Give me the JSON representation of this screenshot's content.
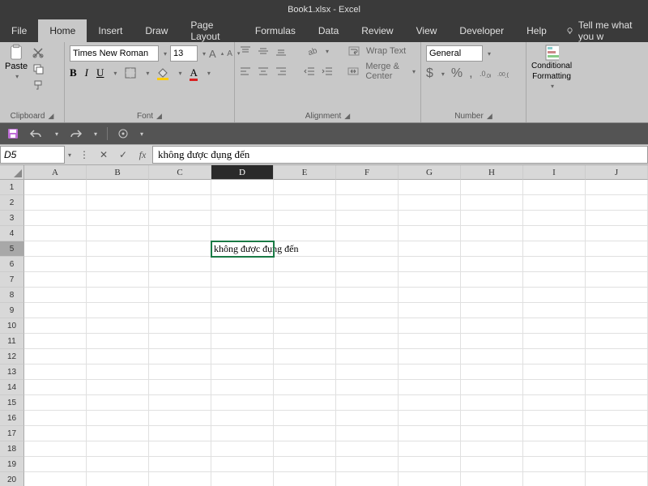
{
  "title": "Book1.xlsx - Excel",
  "menu": {
    "tabs": [
      "File",
      "Home",
      "Insert",
      "Draw",
      "Page Layout",
      "Formulas",
      "Data",
      "Review",
      "View",
      "Developer",
      "Help"
    ],
    "active": "Home",
    "tellme": "Tell me what you w"
  },
  "ribbon": {
    "clipboard": {
      "label": "Clipboard",
      "paste": "Paste"
    },
    "font": {
      "label": "Font",
      "name": "Times New Roman",
      "size": "13",
      "bold": "B",
      "italic": "I",
      "underline": "U",
      "increase": "A",
      "decrease": "A"
    },
    "alignment": {
      "label": "Alignment",
      "wrap": "Wrap Text",
      "merge": "Merge & Center"
    },
    "number": {
      "label": "Number",
      "format": "General",
      "currency": "$",
      "percent": "%",
      "comma": ","
    },
    "styles": {
      "conditional": "Conditional",
      "formatting": "Formatting"
    }
  },
  "namebox": "D5",
  "formula_fx": "fx",
  "formula_value": "không được đụng đến",
  "columns": [
    "A",
    "B",
    "C",
    "D",
    "E",
    "F",
    "G",
    "H",
    "I",
    "J"
  ],
  "active_col_index": 3,
  "rows": 20,
  "active_row": 5,
  "cell_content": {
    "D5": "không được đụng đến"
  }
}
